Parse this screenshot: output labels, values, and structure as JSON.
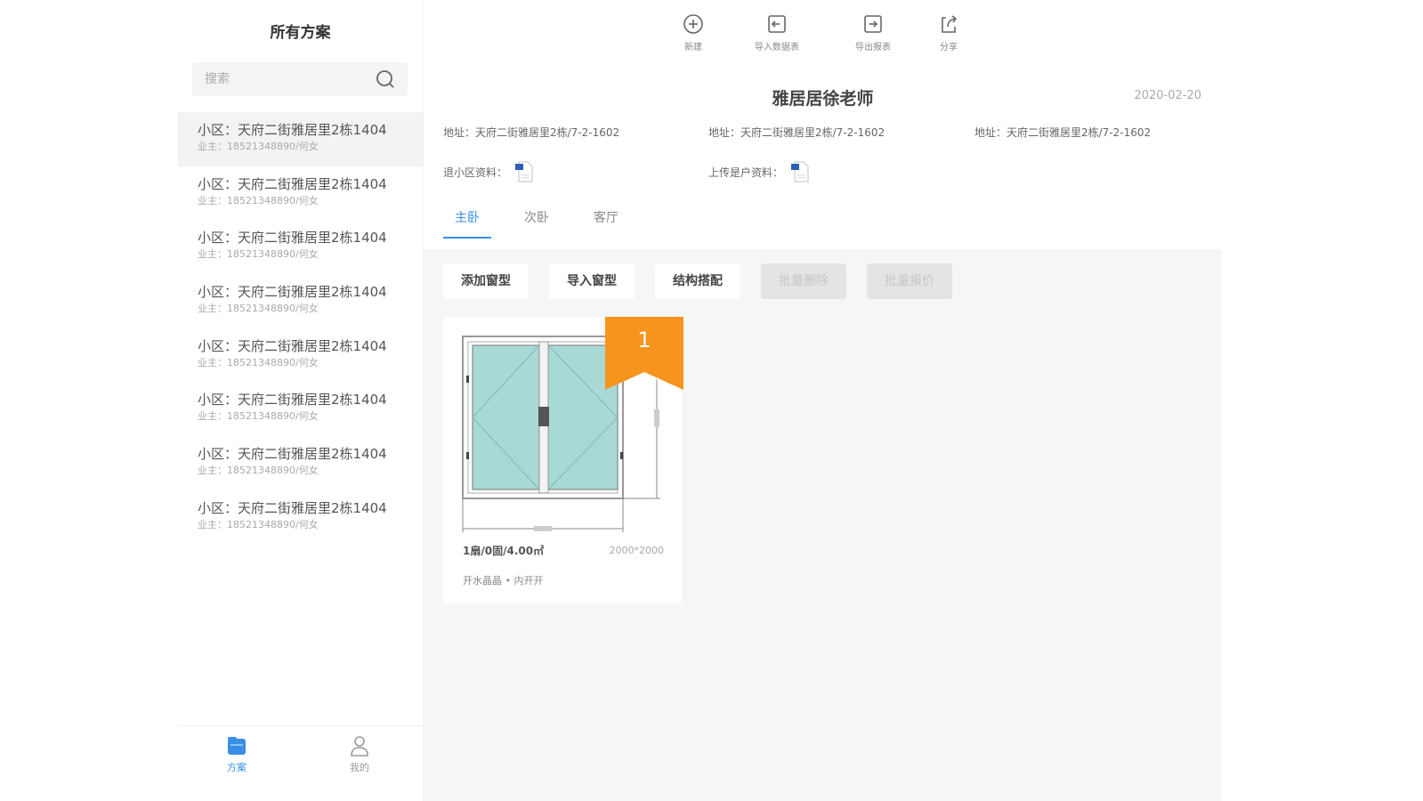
{
  "sidebar": {
    "title": "所有方案",
    "search_placeholder": "搜索",
    "items": [
      {
        "name": "小区：天府二街雅居里2栋1404",
        "sub": "业主：18521348890/何女"
      },
      {
        "name": "小区：天府二街雅居里2栋1404",
        "sub": "业主：18521348890/何女"
      },
      {
        "name": "小区：天府二街雅居里2栋1404",
        "sub": "业主：18521348890/何女"
      },
      {
        "name": "小区：天府二街雅居里2栋1404",
        "sub": "业主：18521348890/何女"
      },
      {
        "name": "小区：天府二街雅居里2栋1404",
        "sub": "业主：18521348890/何女"
      },
      {
        "name": "小区：天府二街雅居里2栋1404",
        "sub": "业主：18521348890/何女"
      },
      {
        "name": "小区：天府二街雅居里2栋1404",
        "sub": "业主：18521348890/何女"
      },
      {
        "name": "小区：天府二街雅居里2栋1404",
        "sub": "业主：18521348890/何女"
      }
    ],
    "nav": {
      "plan": "方案",
      "mine": "我的"
    }
  },
  "toolbar": {
    "new": "新建",
    "import": "导入数据表",
    "export": "导出报表",
    "share": "分享"
  },
  "plan": {
    "title": "雅居居徐老师",
    "date": "2020-02-20",
    "addresses": [
      "地址：天府二街雅居里2栋/7-2-1602",
      "地址：天府二街雅居里2栋/7-2-1602",
      "地址：天府二街雅居里2栋/7-2-1602"
    ],
    "attachments": [
      "退小区资料：",
      "上传是户资料："
    ]
  },
  "tabs": [
    "主卧",
    "次卧",
    "客厅"
  ],
  "actions": [
    "添加窗型",
    "导入窗型",
    "结构搭配",
    "批量删除",
    "批量报价"
  ],
  "card": {
    "badge": "1",
    "name": "1扇/0固/4.00㎡",
    "size": "2000*2000",
    "desc": "开水晶晶 • 内开开"
  },
  "colors": {
    "accent": "#3a8ee6",
    "badge": "#f7941d",
    "glass": "#a9d9d6"
  }
}
